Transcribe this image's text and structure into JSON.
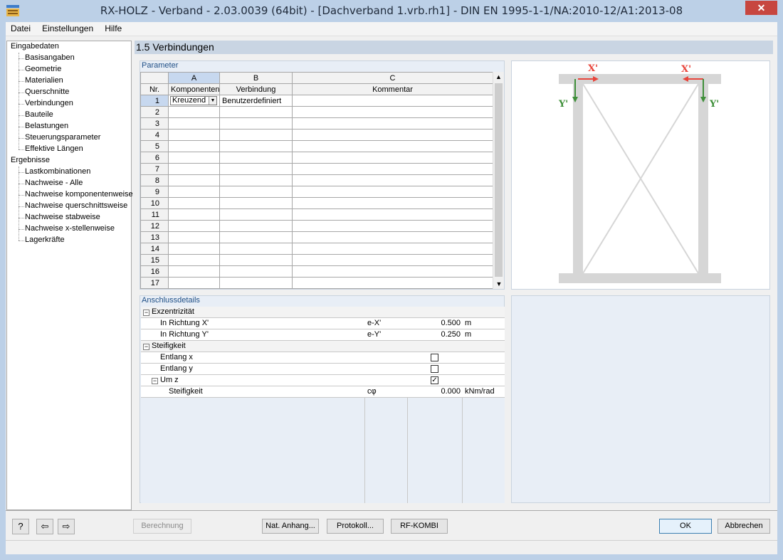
{
  "window": {
    "title": "RX-HOLZ - Verband - 2.03.0039 (64bit) - [Dachverband 1.vrb.rh1] - DIN EN 1995-1-1/NA:2010-12/A1:2013-08",
    "close_label": "✕"
  },
  "menu": [
    "Datei",
    "Einstellungen",
    "Hilfe"
  ],
  "nav": {
    "input_root": "Eingabedaten",
    "input_items": [
      "Basisangaben",
      "Geometrie",
      "Materialien",
      "Querschnitte",
      "Verbindungen",
      "Bauteile",
      "Belastungen",
      "Steuerungsparameter",
      "Effektive Längen"
    ],
    "results_root": "Ergebnisse",
    "results_items": [
      "Lastkombinationen",
      "Nachweise - Alle",
      "Nachweise komponentenweise",
      "Nachweise querschnittsweise",
      "Nachweise stabweise",
      "Nachweise x-stellenweise",
      "Lagerkräfte"
    ]
  },
  "panel": {
    "title": "1.5 Verbindungen"
  },
  "parameter": {
    "label": "Parameter",
    "col_letters": [
      "A",
      "B",
      "C"
    ],
    "row_header": "Nr.",
    "col_names": [
      "Komponenten",
      "Verbindung",
      "Kommentar"
    ],
    "rows": [
      {
        "nr": "1",
        "komponenten": "Kreuzend",
        "verbindung": "Benutzerdefiniert",
        "kommentar": ""
      },
      {
        "nr": "2"
      },
      {
        "nr": "3"
      },
      {
        "nr": "4"
      },
      {
        "nr": "5"
      },
      {
        "nr": "6"
      },
      {
        "nr": "7"
      },
      {
        "nr": "8"
      },
      {
        "nr": "9"
      },
      {
        "nr": "10"
      },
      {
        "nr": "11"
      },
      {
        "nr": "12"
      },
      {
        "nr": "13"
      },
      {
        "nr": "14"
      },
      {
        "nr": "15"
      },
      {
        "nr": "16"
      },
      {
        "nr": "17"
      }
    ]
  },
  "preview": {
    "x_label_left": "X'",
    "x_label_right": "X'",
    "y_label_left": "Y'",
    "y_label_right": "Y'",
    "arrow_red": "#e8453c",
    "arrow_green": "#3f8f3a"
  },
  "details": {
    "label": "Anschlussdetails",
    "exzentrizitaet": "Exzentrizität",
    "row_x": {
      "label": "In Richtung X'",
      "sym": "e-X'",
      "value": "0.500",
      "unit": "m"
    },
    "row_y": {
      "label": "In Richtung Y'",
      "sym": "e-Y'",
      "value": "0.250",
      "unit": "m"
    },
    "steifigkeit_group": "Steifigkeit",
    "entlang_x": "Entlang x",
    "entlang_y": "Entlang y",
    "um_z": "Um z",
    "steifigkeit": {
      "label": "Steifigkeit",
      "sym": "cφ",
      "value": "0.000",
      "unit": "kNm/rad"
    },
    "checks": {
      "entlang_x": false,
      "entlang_y": false,
      "um_z": true
    }
  },
  "buttons": {
    "berechnung": "Berechnung",
    "nat_anhang": "Nat. Anhang...",
    "protokoll": "Protokoll...",
    "rf_kombi": "RF-KOMBI",
    "ok": "OK",
    "abbrechen": "Abbrechen"
  }
}
